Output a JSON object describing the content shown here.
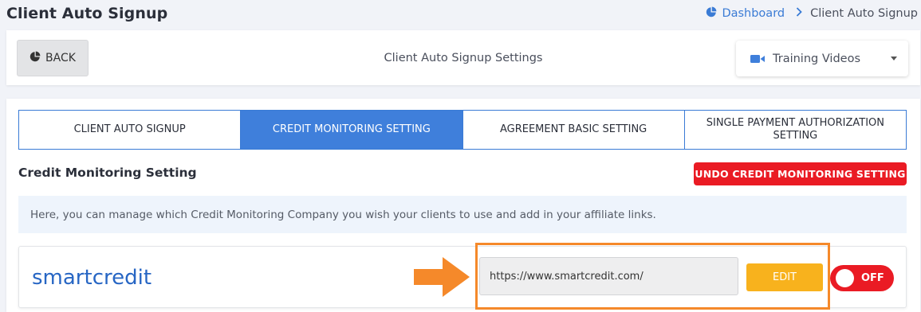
{
  "page": {
    "title": "Client Auto Signup",
    "breadcrumb": {
      "home": "Dashboard",
      "current": "Client Auto Signup"
    }
  },
  "toolbar": {
    "back_label": "BACK",
    "title": "Client Auto Signup Settings",
    "training_label": "Training Videos"
  },
  "tabs": [
    {
      "label": "CLIENT AUTO SIGNUP",
      "active": false
    },
    {
      "label": "CREDIT MONITORING SETTING",
      "active": true
    },
    {
      "label": "AGREEMENT BASIC SETTING",
      "active": false
    },
    {
      "label": "SINGLE PAYMENT AUTHORIZATION SETTING",
      "active": false
    }
  ],
  "section": {
    "title": "Credit Monitoring Setting",
    "undo_label": "UNDO CREDIT MONITORING SETTING",
    "info": "Here, you can manage which Credit Monitoring Company you wish your clients to use and add in your affiliate links."
  },
  "provider": {
    "name": "smartcredit",
    "url": "https://www.smartcredit.com/",
    "edit_label": "EDIT",
    "toggle_label": "OFF"
  },
  "colors": {
    "primary": "#3f7fdb",
    "danger": "#ea1b24",
    "warning": "#f8b21d",
    "highlight": "#f5892a"
  },
  "icons": {
    "dashboard": "pie-chart-icon",
    "back": "pie-chart-icon",
    "training": "video-camera-icon",
    "breadcrumb_separator": "chevron-right-icon"
  }
}
